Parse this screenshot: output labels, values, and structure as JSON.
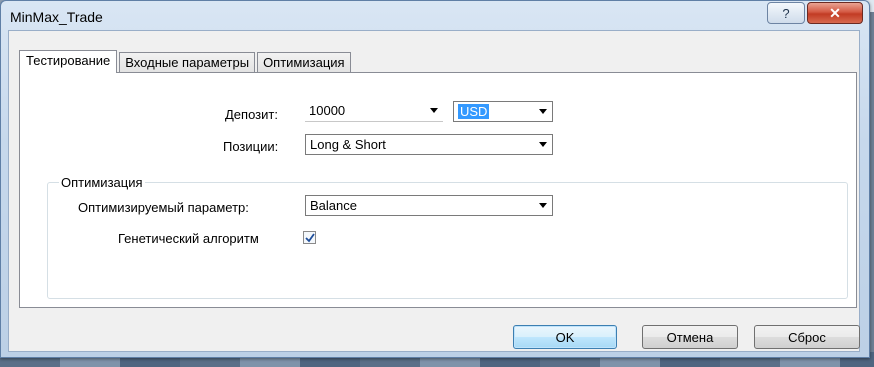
{
  "window": {
    "title": "MinMax_Trade"
  },
  "tabs": [
    {
      "label": "Тестирование",
      "active": true
    },
    {
      "label": "Входные параметры",
      "active": false
    },
    {
      "label": "Оптимизация",
      "active": false
    }
  ],
  "testing": {
    "deposit_label": "Депозит:",
    "deposit_value": "10000",
    "currency_value": "USD",
    "positions_label": "Позиции:",
    "positions_value": "Long & Short"
  },
  "optimization_group": {
    "title": "Оптимизация",
    "param_label": "Оптимизируемый параметр:",
    "param_value": "Balance",
    "genetic_label": "Генетический алгоритм",
    "genetic_checked": true
  },
  "buttons": {
    "ok": "OK",
    "cancel": "Отмена",
    "reset": "Сброс"
  },
  "icons": {
    "help": "?",
    "close": "✕",
    "check": "✓"
  },
  "colors": {
    "close_red": "#c23b24",
    "selection_blue": "#3399ff",
    "default_btn_border": "#3c7fb1"
  }
}
